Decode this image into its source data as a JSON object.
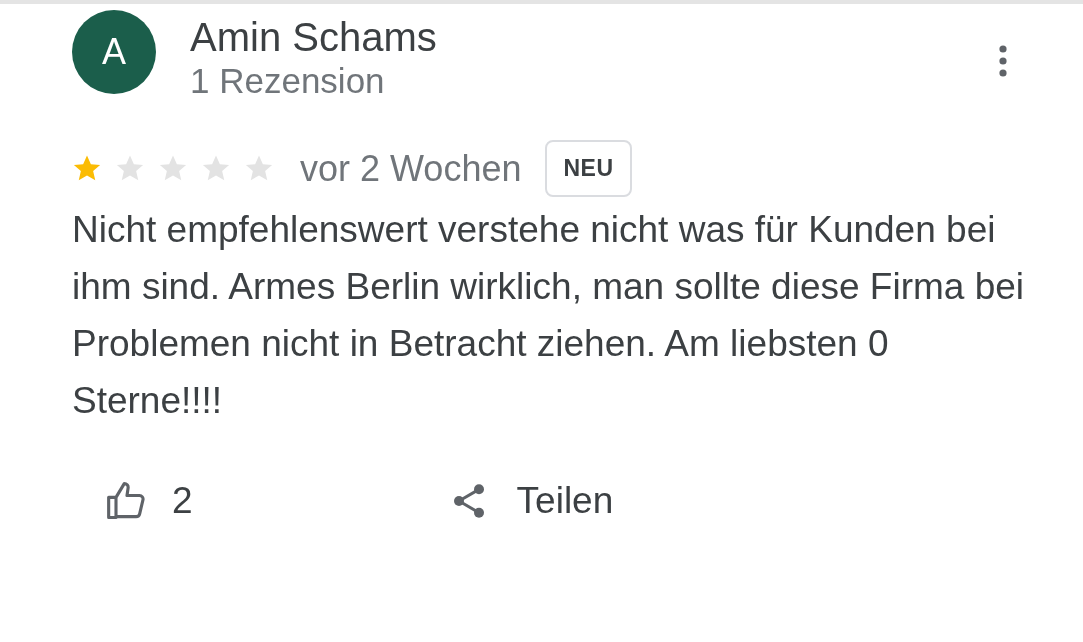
{
  "reviewer": {
    "initial": "A",
    "name": "Amin Schams",
    "review_count": "1 Rezension"
  },
  "review": {
    "stars": 1,
    "time": "vor 2 Wochen",
    "badge": "NEU",
    "text": "Nicht empfehlenswert verstehe nicht was für Kunden bei ihm sind. Armes Berlin wirklich, man sollte diese Firma bei Problemen nicht in Betracht ziehen. Am liebsten 0 Sterne!!!!"
  },
  "actions": {
    "likes": "2",
    "share": "Teilen"
  }
}
